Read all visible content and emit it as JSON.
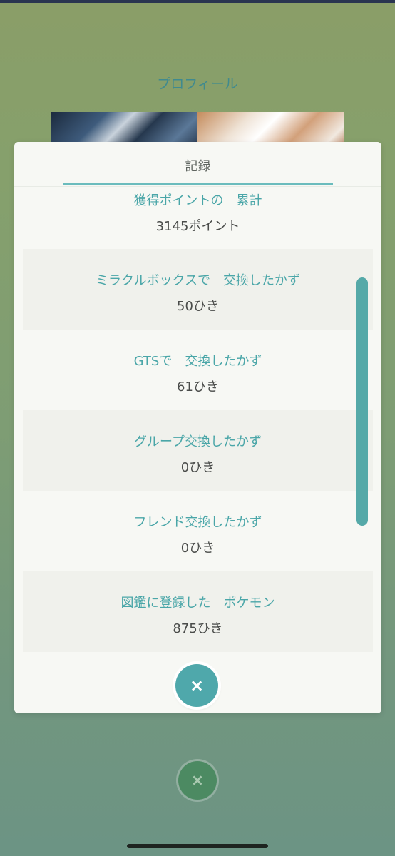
{
  "background": {
    "title": "プロフィール"
  },
  "modal": {
    "title": "記録",
    "records": [
      {
        "label": "獲得ポイントの　累計",
        "value": "3145ポイント"
      },
      {
        "label": "ミラクルボックスで　交換したかず",
        "value": "50ひき"
      },
      {
        "label": "GTSで　交換したかず",
        "value": "61ひき"
      },
      {
        "label": "グループ交換したかず",
        "value": "0ひき"
      },
      {
        "label": "フレンド交換したかず",
        "value": "0ひき"
      },
      {
        "label": "図鑑に登録した　ポケモン",
        "value": "875ひき"
      }
    ],
    "close_icon": "×"
  },
  "colors": {
    "accent": "#4fa8ab",
    "label_text": "#4aa6a8",
    "value_text": "#4a4c4a",
    "modal_bg": "#f7f8f4",
    "row_shaded": "#f0f1ec"
  }
}
